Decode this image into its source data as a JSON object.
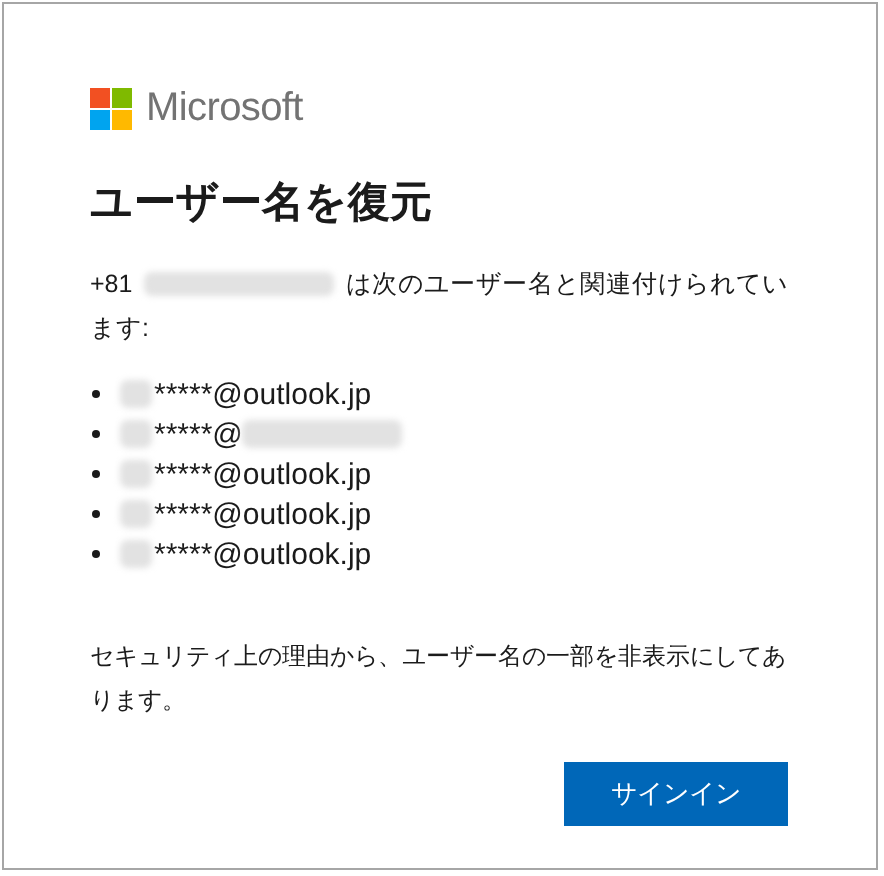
{
  "logo": {
    "text": "Microsoft"
  },
  "title": "ユーザー名を復元",
  "intro": [
    [
      {
        "kind": "text",
        "text": "+81"
      },
      {
        "kind": "redacted"
      },
      {
        "kind": "text",
        "text": "は次のユーザー名と関連付けられてい"
      }
    ],
    [
      {
        "kind": "text",
        "text": "ます:"
      }
    ]
  ],
  "usernames": [
    {
      "segments": [
        {
          "kind": "redacted"
        },
        {
          "kind": "text",
          "text": "*****@outlook.jp"
        }
      ]
    },
    {
      "segments": [
        {
          "kind": "redacted"
        },
        {
          "kind": "text",
          "text": "*****@"
        },
        {
          "kind": "redacted-long"
        }
      ]
    },
    {
      "segments": [
        {
          "kind": "redacted"
        },
        {
          "kind": "text",
          "text": "*****@outlook.jp"
        }
      ]
    },
    {
      "segments": [
        {
          "kind": "redacted"
        },
        {
          "kind": "text",
          "text": "*****@outlook.jp"
        }
      ]
    },
    {
      "segments": [
        {
          "kind": "redacted"
        },
        {
          "kind": "text",
          "text": "*****@outlook.jp"
        }
      ]
    }
  ],
  "note": "セキュリティ上の理由から、ユーザー名の一部を非表示にしてあります。",
  "buttons": [
    "サインイン"
  ]
}
